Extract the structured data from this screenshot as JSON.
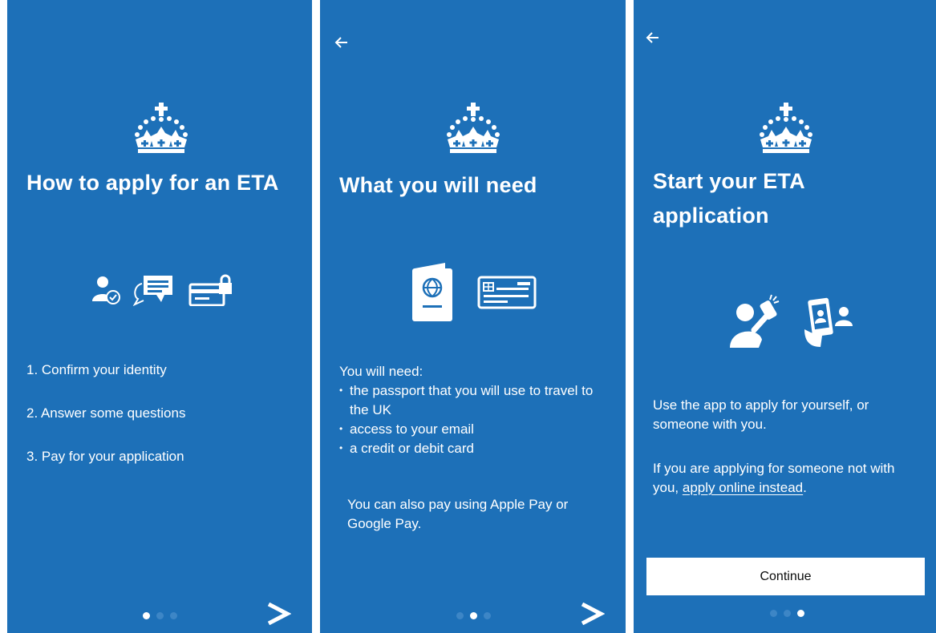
{
  "colors": {
    "background": "#1d70b8",
    "text": "#ffffff",
    "dot_inactive": "#3d86c6",
    "button_bg": "#ffffff",
    "button_text": "#0b0c0c"
  },
  "screen1": {
    "title": "How to apply for an ETA",
    "icons": [
      "person-check-icon",
      "speech-bubble-icon",
      "locked-card-icon"
    ],
    "steps": [
      "1. Confirm your identity",
      "2. Answer some questions",
      "3. Pay for your application"
    ],
    "pager": {
      "active": 1,
      "total": 3
    },
    "next_icon": "chevron-right-icon"
  },
  "screen2": {
    "back_icon": "back-arrow-icon",
    "title": "What you will need",
    "icons": [
      "passport-icon",
      "credit-card-icon"
    ],
    "intro": "You will need:",
    "needs": [
      "the passport that you will use to travel to the UK",
      "access to your email",
      "a credit or debit card"
    ],
    "note": "You can also pay using Apple Pay or Google Pay.",
    "pager": {
      "active": 2,
      "total": 3
    },
    "next_icon": "chevron-right-icon"
  },
  "screen3": {
    "back_icon": "back-arrow-icon",
    "title": "Start your ETA application",
    "icons": [
      "selfie-icon",
      "phone-id-icon"
    ],
    "para1": "Use the app to apply for yourself, or someone with you.",
    "para2_prefix": "If you are applying for someone not with you, ",
    "para2_link": "apply online instead",
    "para2_suffix": ".",
    "continue_label": "Continue",
    "pager": {
      "active": 3,
      "total": 3
    }
  }
}
